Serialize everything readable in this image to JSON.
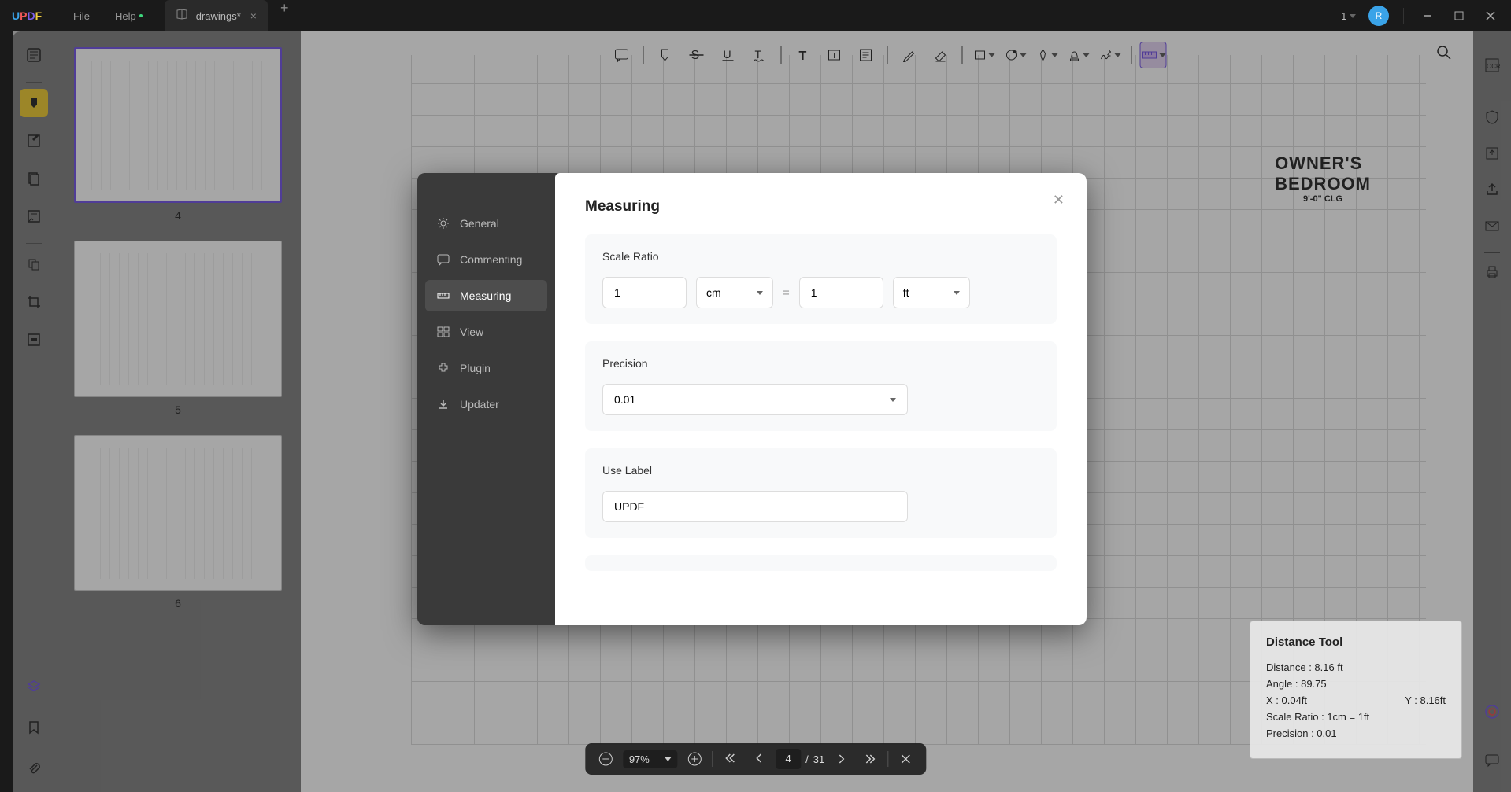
{
  "app": {
    "logo_parts": [
      "U",
      "P",
      "D",
      "F"
    ]
  },
  "menu": {
    "file": "File",
    "help": "Help"
  },
  "tabs": {
    "active_label": "drawings*"
  },
  "window": {
    "count": "1",
    "avatar": "R"
  },
  "toolbar_icons": [
    "comment",
    "highlight",
    "strikethrough",
    "underline",
    "text-edit",
    "text",
    "textbox",
    "note",
    "pencil",
    "color",
    "shape",
    "circle",
    "pin",
    "stamp",
    "signature",
    "measure"
  ],
  "thumbnails": [
    {
      "num": "4",
      "active": true
    },
    {
      "num": "5",
      "active": false
    },
    {
      "num": "6",
      "active": false
    }
  ],
  "drawing": {
    "room_title": "OWNER'S",
    "room_sub": "BEDROOM",
    "ceiling": "9'-0\" CLG"
  },
  "dialog": {
    "title": "Measuring",
    "tabs": {
      "general": "General",
      "commenting": "Commenting",
      "measuring": "Measuring",
      "view": "View",
      "plugin": "Plugin",
      "updater": "Updater"
    },
    "sections": {
      "scale_ratio": "Scale Ratio",
      "precision": "Precision",
      "use_label": "Use Label"
    },
    "scale": {
      "val1": "1",
      "unit1": "cm",
      "eq": "=",
      "val2": "1",
      "unit2": "ft"
    },
    "precision_value": "0.01",
    "label_value": "UPDF"
  },
  "bottom_bar": {
    "zoom": "97%",
    "page_current": "4",
    "page_sep": "/",
    "page_total": "31"
  },
  "distance_tool": {
    "title": "Distance Tool",
    "distance": "Distance : 8.16 ft",
    "angle": "Angle : 89.75",
    "x": "X : 0.04ft",
    "y": "Y : 8.16ft",
    "scale_ratio": "Scale Ratio : 1cm = 1ft",
    "precision": "Precision : 0.01"
  }
}
